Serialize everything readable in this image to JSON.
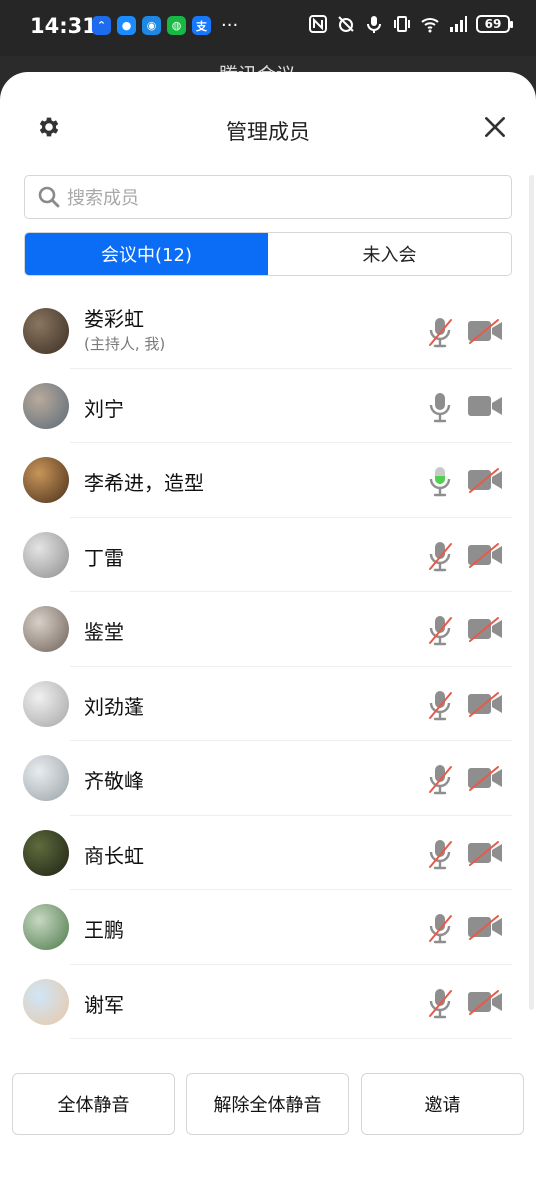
{
  "status_bar": {
    "time": "14:31",
    "more": "···",
    "battery": "69",
    "app_icons": [
      {
        "name": "work-app-icon",
        "color": "#1d6cf0",
        "glyph": "⌃"
      },
      {
        "name": "message-app-icon",
        "color": "#1a8cff",
        "glyph": "●"
      },
      {
        "name": "qq-app-icon",
        "color": "#1e88e5",
        "glyph": "◉"
      },
      {
        "name": "wechat-app-icon",
        "color": "#17b843",
        "glyph": "◍"
      },
      {
        "name": "alipay-app-icon",
        "color": "#1677ff",
        "glyph": "支"
      }
    ]
  },
  "background": {
    "title": "腾讯会议 ⌄"
  },
  "header": {
    "title": "管理成员",
    "settings_icon": "gear-icon",
    "close_icon": "close-icon"
  },
  "search": {
    "placeholder": "搜索成员",
    "value": ""
  },
  "tabs": [
    {
      "label": "会议中(12)",
      "active": true
    },
    {
      "label": "未入会",
      "active": false
    }
  ],
  "members": [
    {
      "name": "娄彩虹",
      "subtitle": "(主持人, 我)",
      "mic": "muted",
      "camera": "off",
      "avatar_colors": [
        "#8a7560",
        "#3a2e22"
      ]
    },
    {
      "name": "刘宁",
      "subtitle": "",
      "mic": "on",
      "camera": "on",
      "avatar_colors": [
        "#b8aa9c",
        "#5a6a78"
      ]
    },
    {
      "name": "李希进，造型",
      "subtitle": "",
      "mic": "speaking",
      "camera": "off",
      "avatar_colors": [
        "#c8955a",
        "#4a2f1a"
      ]
    },
    {
      "name": "丁雷",
      "subtitle": "",
      "mic": "muted",
      "camera": "off",
      "avatar_colors": [
        "#e4e4e4",
        "#8d8d8d"
      ]
    },
    {
      "name": "鉴堂",
      "subtitle": "",
      "mic": "muted",
      "camera": "off",
      "avatar_colors": [
        "#d8d0c8",
        "#6e6258"
      ]
    },
    {
      "name": "刘劲蓬",
      "subtitle": "",
      "mic": "muted",
      "camera": "off",
      "avatar_colors": [
        "#f0f0f0",
        "#a5a5a5"
      ]
    },
    {
      "name": "齐敬峰",
      "subtitle": "",
      "mic": "muted",
      "camera": "off",
      "avatar_colors": [
        "#e8ecef",
        "#9aa3a8"
      ]
    },
    {
      "name": "商长虹",
      "subtitle": "",
      "mic": "muted",
      "camera": "off",
      "avatar_colors": [
        "#5f6b3e",
        "#1e2212"
      ]
    },
    {
      "name": "王鹏",
      "subtitle": "",
      "mic": "muted",
      "camera": "off",
      "avatar_colors": [
        "#c7d7c2",
        "#4d7a4a"
      ]
    },
    {
      "name": "谢军",
      "subtitle": "",
      "mic": "muted",
      "camera": "off",
      "avatar_colors": [
        "#cfe6f7",
        "#e9c7a7"
      ]
    }
  ],
  "actions": {
    "mute_all": "全体静音",
    "unmute_all": "解除全体静音",
    "invite": "邀请"
  },
  "colors": {
    "accent": "#0b6cf6",
    "icon_gray": "#8e8e8e",
    "muted_slash": "#e8594a",
    "speaking": "#4fd04f"
  }
}
